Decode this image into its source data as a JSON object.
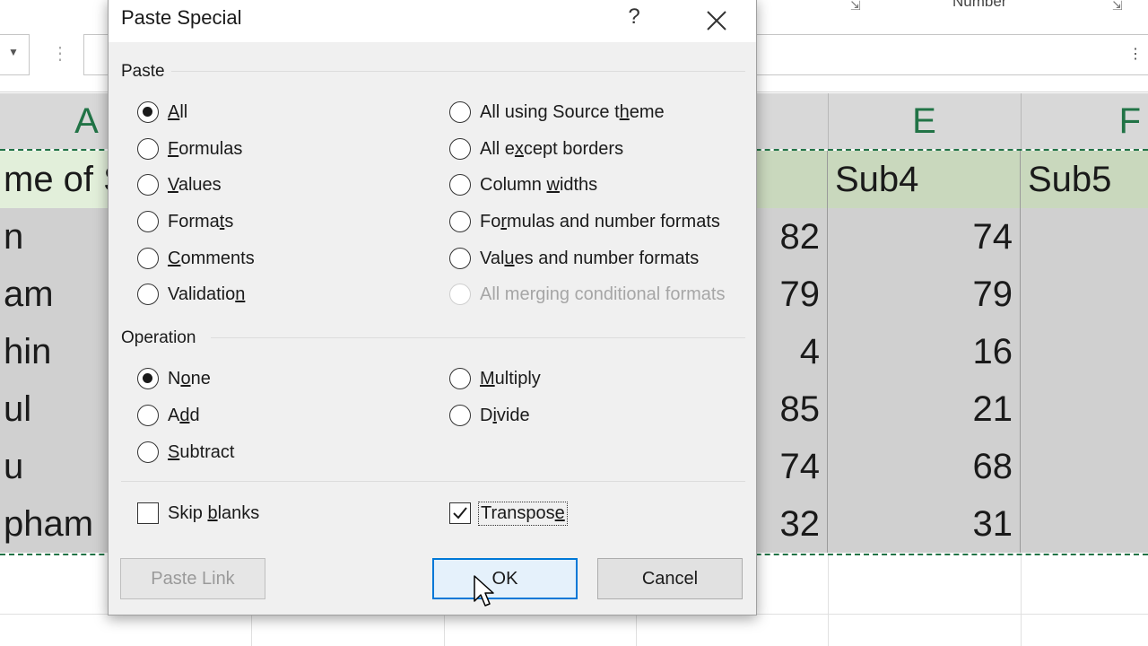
{
  "ribbon": {
    "number_group_label": "Number"
  },
  "sheet": {
    "columns": [
      {
        "label": "A"
      },
      {
        "label": "E"
      },
      {
        "label": "F"
      }
    ],
    "header_row": [
      "me of S",
      "",
      "Sub4",
      "Sub5"
    ],
    "rows": [
      [
        "n",
        "82",
        "74",
        ""
      ],
      [
        "am",
        "79",
        "79",
        ""
      ],
      [
        "hin",
        "4",
        "16",
        ""
      ],
      [
        "ul",
        "85",
        "21",
        ""
      ],
      [
        "u",
        "74",
        "68",
        ""
      ],
      [
        "pham",
        "32",
        "31",
        ""
      ]
    ]
  },
  "dialog": {
    "title": "Paste Special",
    "help": "?",
    "paste_group": {
      "label": "Paste",
      "options_left": [
        {
          "pre": "",
          "key": "A",
          "post": "ll",
          "checked": true
        },
        {
          "pre": "",
          "key": "F",
          "post": "ormulas",
          "checked": false
        },
        {
          "pre": "",
          "key": "V",
          "post": "alues",
          "checked": false
        },
        {
          "pre": "Forma",
          "key": "t",
          "post": "s",
          "checked": false
        },
        {
          "pre": "",
          "key": "C",
          "post": "omments",
          "checked": false
        },
        {
          "pre": "Validatio",
          "key": "n",
          "post": "",
          "checked": false
        }
      ],
      "options_right": [
        {
          "pre": "All using Source t",
          "key": "h",
          "post": "eme",
          "checked": false,
          "disabled": false
        },
        {
          "pre": "All e",
          "key": "x",
          "post": "cept borders",
          "checked": false,
          "disabled": false
        },
        {
          "pre": "Column ",
          "key": "w",
          "post": "idths",
          "checked": false,
          "disabled": false
        },
        {
          "pre": "Fo",
          "key": "r",
          "post": "mulas and number formats",
          "checked": false,
          "disabled": false
        },
        {
          "pre": "Val",
          "key": "u",
          "post": "es and number formats",
          "checked": false,
          "disabled": false
        },
        {
          "pre": "All merging conditional formats",
          "key": "",
          "post": "",
          "checked": false,
          "disabled": true
        }
      ]
    },
    "operation_group": {
      "label": "Operation",
      "options_left": [
        {
          "pre": "N",
          "key": "o",
          "post": "ne",
          "checked": true
        },
        {
          "pre": "A",
          "key": "d",
          "post": "d",
          "checked": false
        },
        {
          "pre": "",
          "key": "S",
          "post": "ubtract",
          "checked": false
        }
      ],
      "options_right": [
        {
          "pre": "",
          "key": "M",
          "post": "ultiply",
          "checked": false
        },
        {
          "pre": "D",
          "key": "i",
          "post": "vide",
          "checked": false
        }
      ]
    },
    "skip_blanks": {
      "pre": "Skip ",
      "key": "b",
      "post": "lanks",
      "checked": false
    },
    "transpose": {
      "pre": "Transpos",
      "key": "e",
      "post": "",
      "checked": true
    },
    "buttons": {
      "paste_link": "Paste Link",
      "ok": "OK",
      "cancel": "Cancel"
    }
  }
}
